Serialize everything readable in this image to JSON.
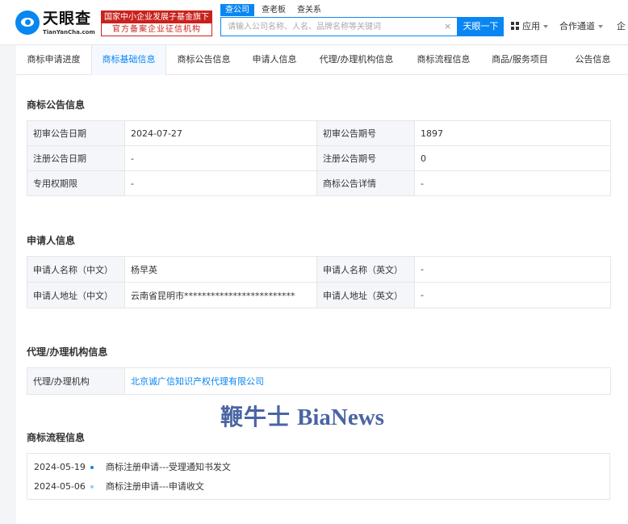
{
  "header": {
    "logo_name": "天眼查",
    "logo_domain": "TianYanCha.com",
    "badge_top": "国家中小企业发展子基金旗下",
    "badge_bottom": "官方备案企业征信机构",
    "search_tabs": [
      "查公司",
      "查老板",
      "查关系"
    ],
    "search_placeholder": "请输入公司名称、人名、品牌名称等关键词",
    "search_clear": "×",
    "search_button": "天眼一下",
    "apps_label": "应用",
    "coop_label": "合作通道",
    "more_label": "企"
  },
  "tabs": [
    "商标申请进度",
    "商标基础信息",
    "商标公告信息",
    "申请人信息",
    "代理/办理机构信息",
    "商标流程信息",
    "商品/服务项目",
    "公告信息"
  ],
  "announcement": {
    "title": "商标公告信息",
    "rows": [
      [
        "初审公告日期",
        "2024-07-27",
        "初审公告期号",
        "1897"
      ],
      [
        "注册公告日期",
        "-",
        "注册公告期号",
        "0"
      ],
      [
        "专用权期限",
        "-",
        "商标公告详情",
        "-"
      ]
    ]
  },
  "applicant": {
    "title": "申请人信息",
    "rows": [
      [
        "申请人名称（中文）",
        "杨早英",
        "申请人名称（英文）",
        "-"
      ],
      [
        "申请人地址（中文）",
        "云南省昆明市*************************",
        "申请人地址（英文）",
        "-"
      ]
    ]
  },
  "agency": {
    "title": "代理/办理机构信息",
    "label": "代理/办理机构",
    "value": "北京诚广信知识产权代理有限公司"
  },
  "watermark": {
    "cn": "鞭牛士",
    "en": "BiaNews"
  },
  "flow": {
    "title": "商标流程信息",
    "items": [
      {
        "date": "2024-05-19",
        "text": "商标注册申请---受理通知书发文"
      },
      {
        "date": "2024-05-06",
        "text": "商标注册申请---申请收文"
      }
    ]
  },
  "colors": {
    "brand_blue": "#0a86f2",
    "badge_red": "#c9221d"
  }
}
